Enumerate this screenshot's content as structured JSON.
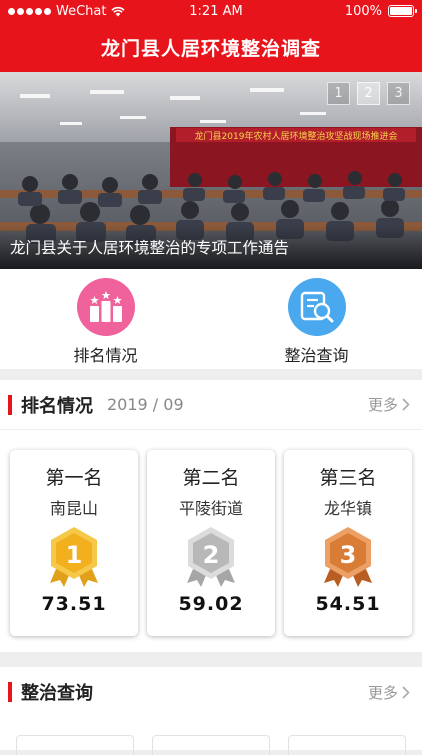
{
  "status": {
    "carrier": "WeChat",
    "time": "1:21 AM",
    "battery": "100%"
  },
  "nav": {
    "title": "龙门县人居环境整治调查"
  },
  "banner": {
    "caption": "龙门县关于人居环境整治的专项工作通告",
    "pages": [
      "1",
      "2",
      "3"
    ],
    "active_page": 2,
    "slogan": "龙门县2019年农村人居环境整治攻坚战现场推进会"
  },
  "quick": [
    {
      "label": "排名情况",
      "icon": "ranking-chart-icon"
    },
    {
      "label": "整治查询",
      "icon": "document-search-icon"
    }
  ],
  "ranking": {
    "title": "排名情况",
    "date": "2019 / 09",
    "more": "更多",
    "cards": [
      {
        "rank": "第一名",
        "name": "南昆山",
        "score": "73.51",
        "medal_digit": "1",
        "medal": "gold-medal-icon"
      },
      {
        "rank": "第二名",
        "name": "平陵街道",
        "score": "59.02",
        "medal_digit": "2",
        "medal": "silver-medal-icon"
      },
      {
        "rank": "第三名",
        "name": "龙华镇",
        "score": "54.51",
        "medal_digit": "3",
        "medal": "bronze-medal-icon"
      }
    ]
  },
  "inquiry": {
    "title": "整治查询",
    "more": "更多"
  },
  "colors": {
    "brand": "#e8141c",
    "pink": "#f0629b",
    "blue": "#4aa8ee",
    "gold": "#f2b01e",
    "silver": "#b8b8b8",
    "bronze": "#d97c35"
  }
}
